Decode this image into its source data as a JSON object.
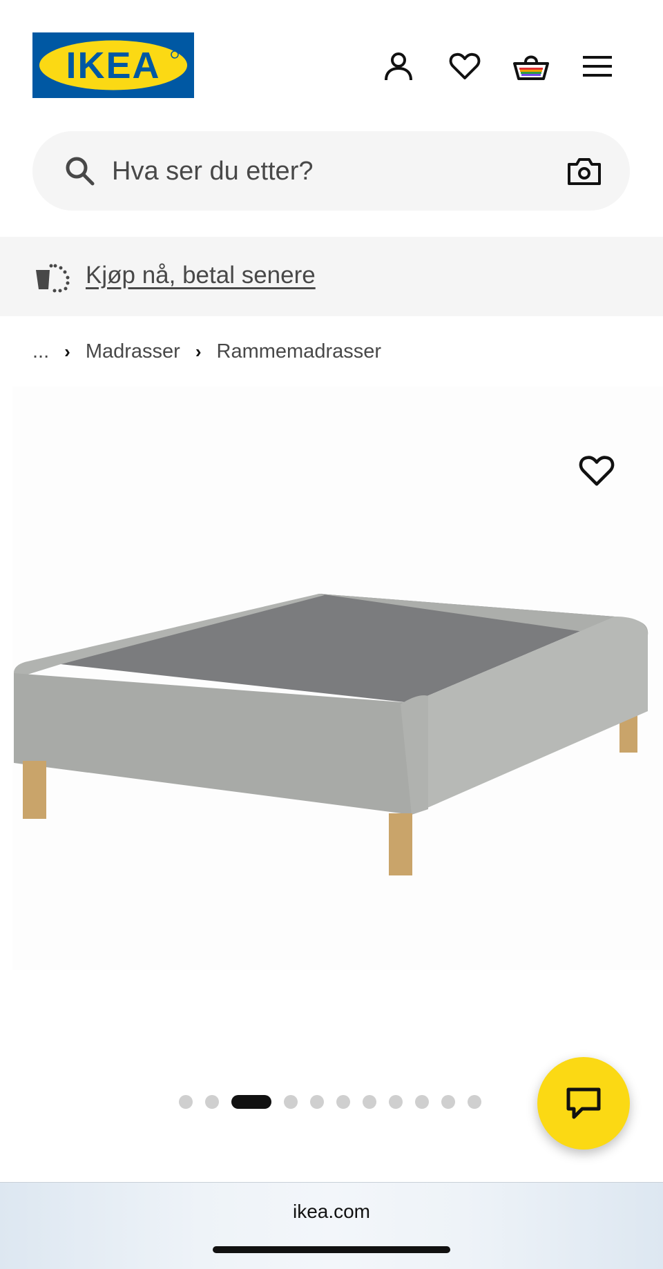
{
  "brand": {
    "logo_text": "IKEA",
    "blue": "#0058a3",
    "yellow": "#fbd914"
  },
  "header": {
    "icons": [
      "account-icon",
      "heart-icon",
      "basket-icon",
      "menu-icon"
    ]
  },
  "search": {
    "placeholder": "Hva ser du etter?"
  },
  "promo": {
    "text": "Kjøp nå, betal senere"
  },
  "breadcrumb": {
    "items": [
      "...",
      "Madrasser",
      "Rammemadrasser"
    ]
  },
  "gallery": {
    "image_count": 11,
    "active_index": 2
  },
  "browser": {
    "url": "ikea.com"
  }
}
